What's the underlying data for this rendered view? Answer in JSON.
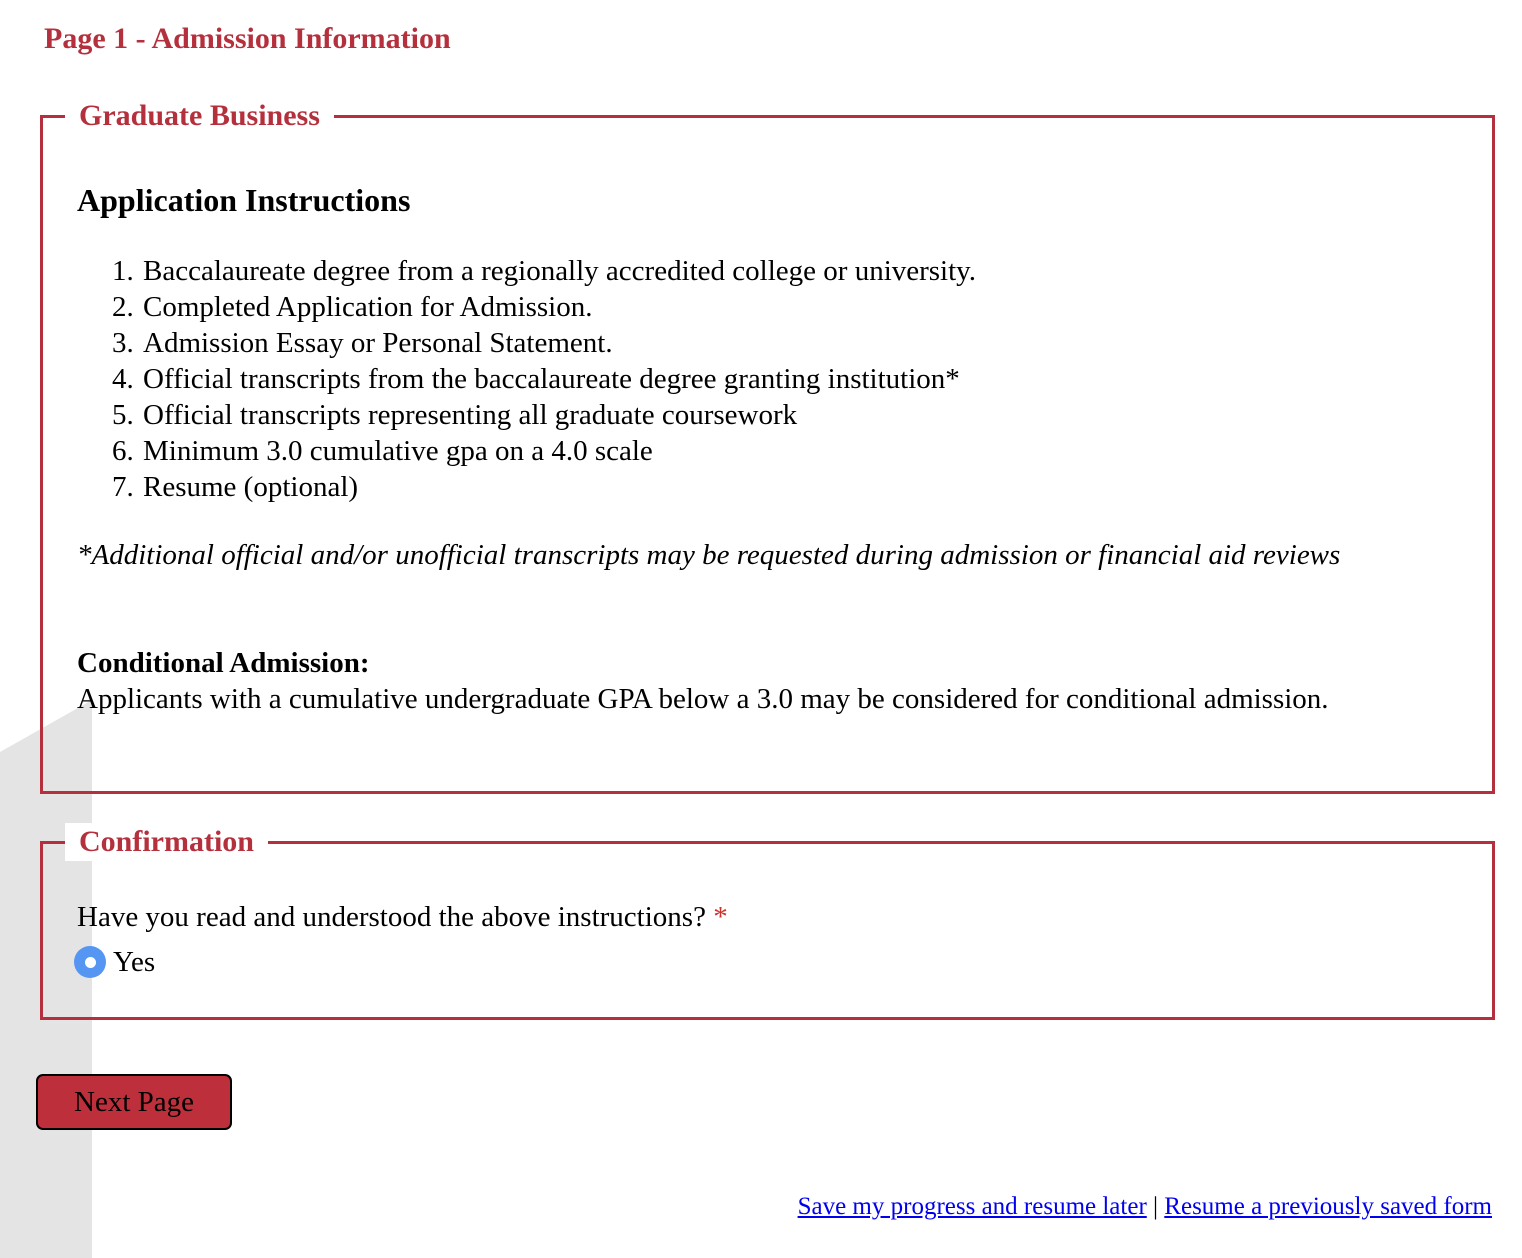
{
  "page": {
    "title": "Page 1 - Admission Information"
  },
  "sections": {
    "graduate_business": {
      "legend": "Graduate Business",
      "heading": "Application Instructions",
      "requirements": [
        "Baccalaureate degree from a regionally accredited college or university.",
        "Completed Application for Admission.",
        "Admission Essay or Personal Statement.",
        "Official transcripts from the baccalaureate degree granting institution*",
        "Official transcripts representing all graduate coursework",
        "Minimum 3.0 cumulative gpa on a 4.0 scale",
        "Resume (optional)"
      ],
      "note": "*Additional official and/or unofficial transcripts may be requested during admission or financial aid reviews",
      "conditional_heading": "Conditional Admission:",
      "conditional_text": "Applicants with a cumulative undergraduate GPA below a 3.0 may be considered for conditional admission."
    },
    "confirmation": {
      "legend": "Confirmation",
      "question": "Have you read and understood the above instructions?",
      "required_marker": "*",
      "options": [
        {
          "label": "Yes",
          "selected": true
        }
      ]
    }
  },
  "actions": {
    "next_label": "Next Page"
  },
  "footer": {
    "save_link": "Save my progress and resume later",
    "separator": "|",
    "resume_link": "Resume a previously saved form"
  },
  "colors": {
    "accent": "#b5303d",
    "button": "#be2f3c",
    "radio": "#5596f2",
    "link": "#0000ee",
    "required": "#d0312d"
  }
}
